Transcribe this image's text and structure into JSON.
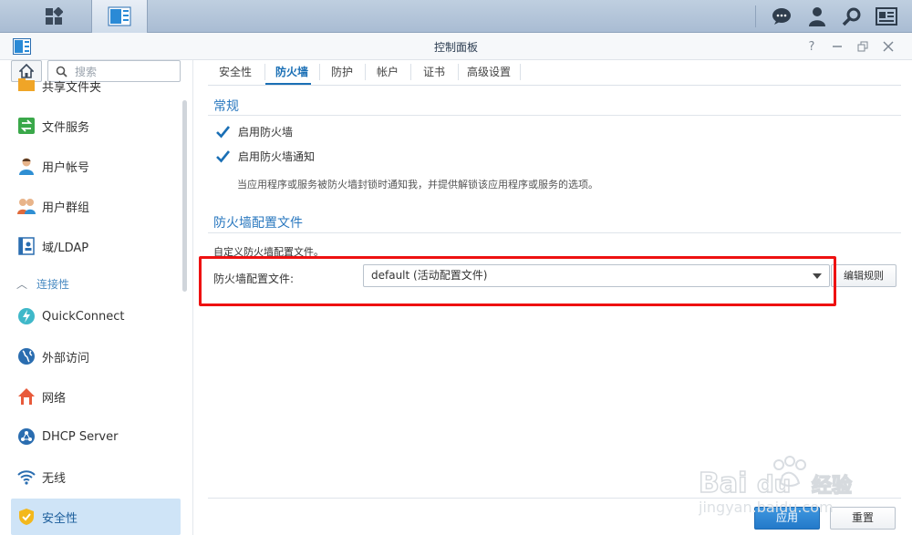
{
  "window": {
    "title": "控制面板"
  },
  "sidebar": {
    "search_placeholder": "搜索",
    "items": [
      {
        "label": "共享文件夹",
        "icon": "shared-folder-icon"
      },
      {
        "label": "文件服务",
        "icon": "file-services-icon"
      },
      {
        "label": "用户帐号",
        "icon": "user-icon"
      },
      {
        "label": "用户群组",
        "icon": "group-icon"
      },
      {
        "label": "域/LDAP",
        "icon": "domain-ldap-icon"
      },
      {
        "label": "QuickConnect",
        "icon": "quickconnect-icon"
      },
      {
        "label": "外部访问",
        "icon": "external-access-icon"
      },
      {
        "label": "网络",
        "icon": "network-icon"
      },
      {
        "label": "DHCP Server",
        "icon": "dhcp-server-icon"
      },
      {
        "label": "无线",
        "icon": "wireless-icon"
      },
      {
        "label": "安全性",
        "icon": "security-shield-icon",
        "active": true
      }
    ],
    "group_label": "连接性"
  },
  "tabs": [
    {
      "label": "安全性"
    },
    {
      "label": "防火墙",
      "active": true
    },
    {
      "label": "防护"
    },
    {
      "label": "帐户"
    },
    {
      "label": "证书"
    },
    {
      "label": "高级设置"
    }
  ],
  "general": {
    "title": "常规",
    "enable_firewall": {
      "label": "启用防火墙",
      "checked": true
    },
    "enable_notify": {
      "label": "启用防火墙通知",
      "checked": true
    },
    "notify_note": "当应用程序或服务被防火墙封锁时通知我，并提供解锁该应用程序或服务的选项。"
  },
  "profile": {
    "title": "防火墙配置文件",
    "description": "自定义防火墙配置文件。",
    "field_label": "防火墙配置文件:",
    "selected": "default (活动配置文件)",
    "edit_rules": "编辑规则"
  },
  "footer": {
    "apply": "应用",
    "reset": "重置"
  },
  "watermark": {
    "brand": "Bai du 经验",
    "url": "jingyan.baidu.com"
  },
  "colors": {
    "accent": "#2379c9",
    "highlight": "#e11111",
    "checkbox": "#1a6fb5"
  }
}
